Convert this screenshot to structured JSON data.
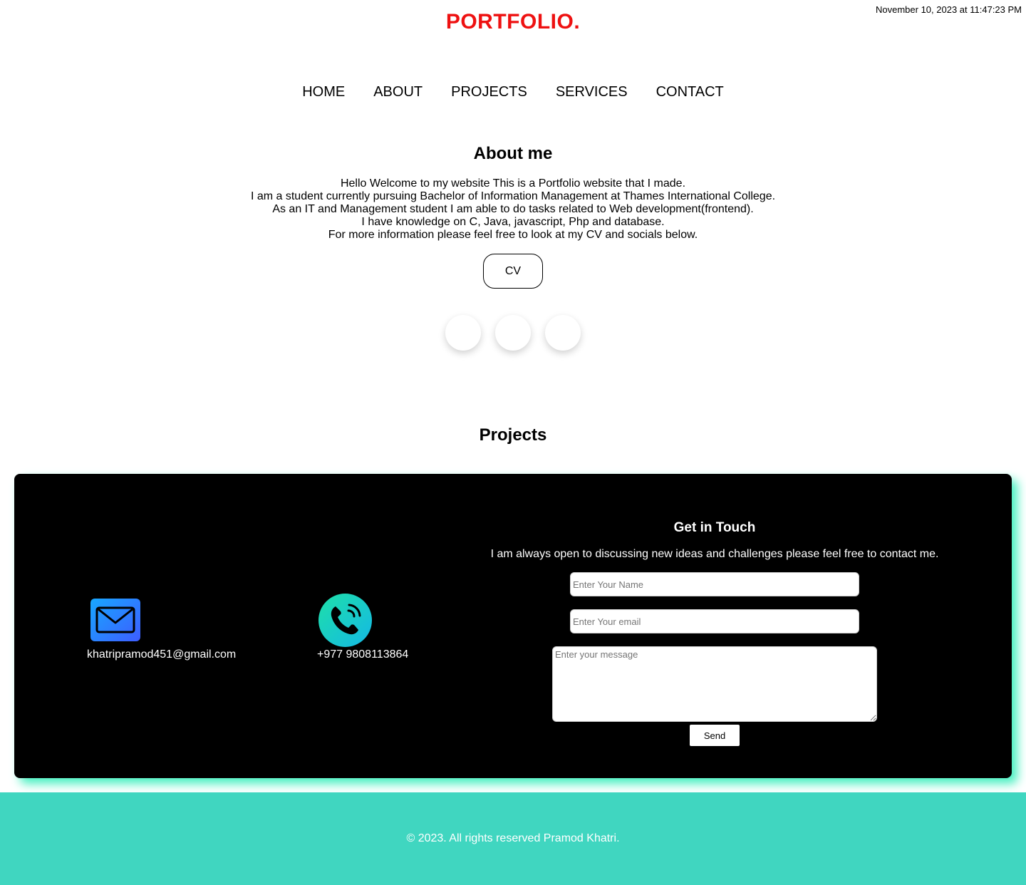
{
  "header": {
    "timestamp": "November 10, 2023 at 11:47:23 PM",
    "brand": "PORTFOLIO."
  },
  "nav": {
    "items": [
      "HOME",
      "ABOUT",
      "PROJECTS",
      "SERVICES",
      "CONTACT"
    ]
  },
  "about": {
    "title": "About me",
    "lines": [
      "Hello Welcome to my website This is a Portfolio website that I made.",
      "I am a student currently pursuing Bachelor of Information Management at Thames International College.",
      "As an IT and Management student I am able to do tasks related to Web development(frontend).",
      "I have knowledge on C, Java, javascript, Php and database.",
      "For more information please feel free to look at my CV and socials below."
    ],
    "cv_label": "CV"
  },
  "projects": {
    "title": "Projects"
  },
  "contact": {
    "email": "khatripramod451@gmail.com",
    "phone": "+977 9808113864",
    "title": "Get in Touch",
    "text": "I am always open to discussing new ideas and challenges please feel free to contact me.",
    "name_placeholder": "Enter Your Name",
    "email_placeholder": "Enter Your email",
    "message_placeholder": "Enter your message",
    "send_label": "Send"
  },
  "footer": {
    "text": "© 2023. All rights reserved Pramod Khatri."
  },
  "colors": {
    "brand": "#ee1111",
    "panel_shadow": "#45f0c0",
    "footer_bg": "#40d6c0"
  },
  "icons": {
    "social": [
      "social-icon-1",
      "social-icon-2",
      "social-icon-3"
    ],
    "mail": "mail-icon",
    "phone": "phone-icon"
  }
}
